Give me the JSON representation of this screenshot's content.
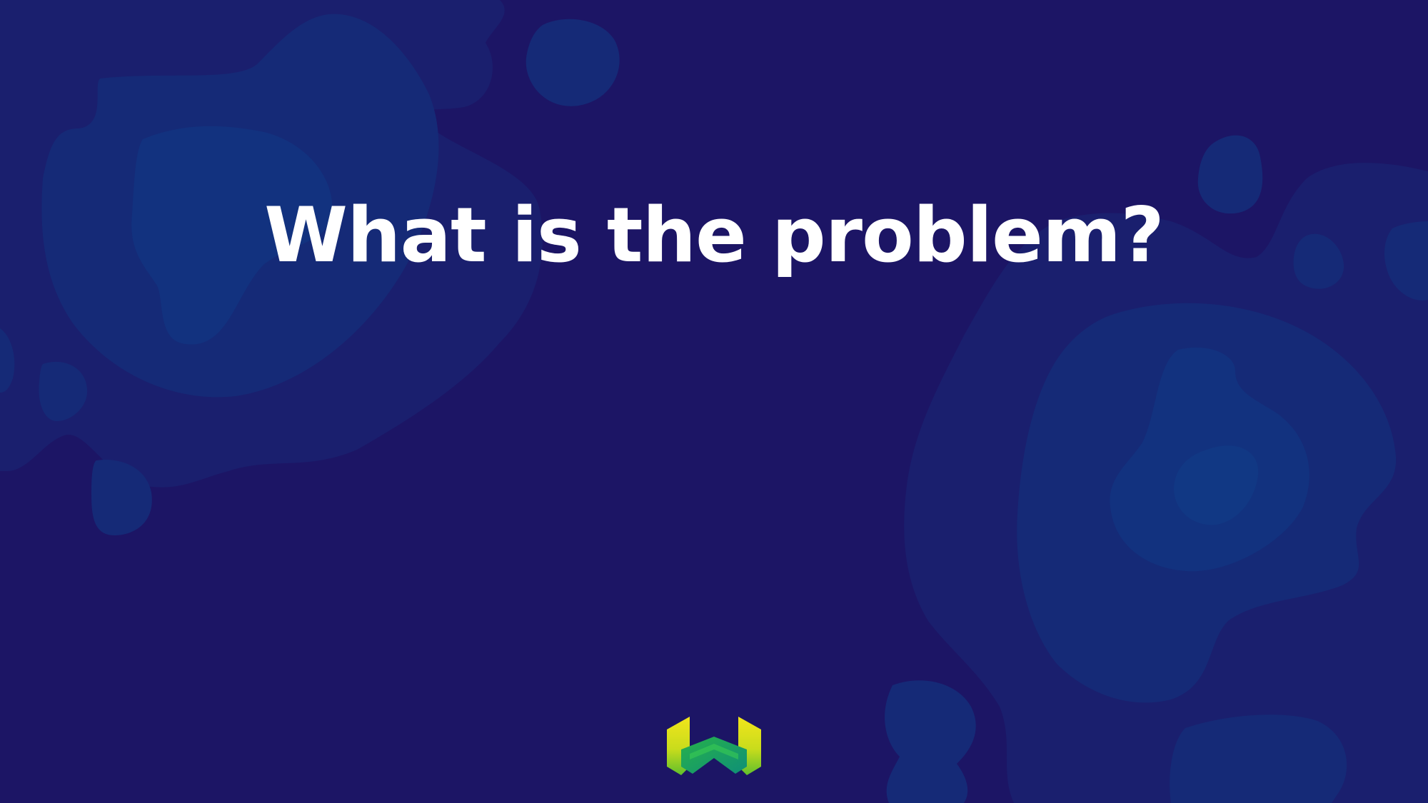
{
  "slide": {
    "title": "What is the problem?",
    "logo_icon": "w-brand-logo-icon"
  },
  "colors": {
    "background": "#1c1565",
    "blob_outer": "#1a1f6e",
    "blob_mid": "#152a77",
    "blob_inner": "#12327f",
    "title_text": "#ffffff",
    "logo_yellow": "#e6e21a",
    "logo_green": "#3bbf3a",
    "logo_teal": "#16a085"
  }
}
